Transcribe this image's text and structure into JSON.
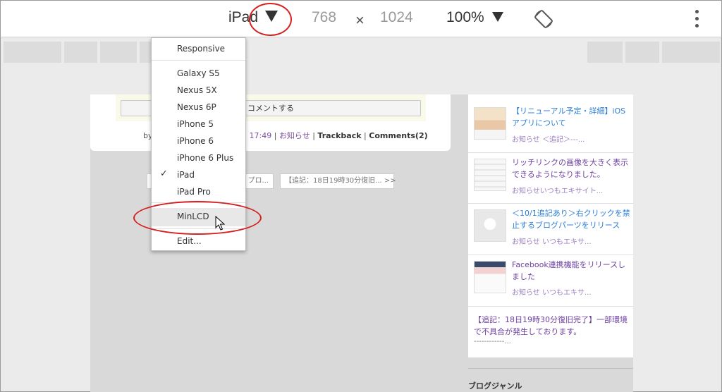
{
  "toolbar": {
    "device": "iPad",
    "width": "768",
    "times": "×",
    "height": "1024",
    "zoom": "100%",
    "rotate_icon": "rotate-icon",
    "more_icon": "more-vert-icon"
  },
  "dropdown": {
    "responsive": "Responsive",
    "devices": [
      "Galaxy S5",
      "Nexus 5X",
      "Nexus 6P",
      "iPhone 5",
      "iPhone 6",
      "iPhone 6 Plus",
      "iPad",
      "iPad Pro"
    ],
    "checked": "iPad",
    "custom": "MinLCD",
    "edit": "Edit..."
  },
  "page": {
    "comment_button": "コメントする",
    "meta_by": "by",
    "meta_time": "17:49",
    "meta_sep": "|",
    "meta_category": "お知らせ",
    "meta_trackback": "Trackback",
    "meta_comments": "Comments(2)",
    "pager_prev": "プロ...",
    "pager_next": "【追記：18日19時30分復旧... >>"
  },
  "sidebar": {
    "items": [
      {
        "title": "【リニューアル予定・詳細】iOSアプリについて",
        "sub": "お知らせ ＜追記＞---..."
      },
      {
        "title": "リッチリンクの画像を大きく表示できるようになりました。",
        "sub": "お知らせいつもエキサイト..."
      },
      {
        "title": "＜10/1追記あり＞右クリックを禁止するブログパーツをリリース",
        "sub": "お知らせ いつもエキサ..."
      },
      {
        "title": "Facebook連携機能をリリースしました",
        "sub": "お知らせ いつもエキサ..."
      },
      {
        "title": "【追記：18日19時30分復旧完了】一部環境で不具合が発生しております。",
        "sub": "------------..."
      }
    ],
    "genre": "ブログジャンル"
  },
  "colors": {
    "annotation": "#d62020",
    "link_blue": "#2b7fd4",
    "link_purple": "#6c3fa0"
  }
}
